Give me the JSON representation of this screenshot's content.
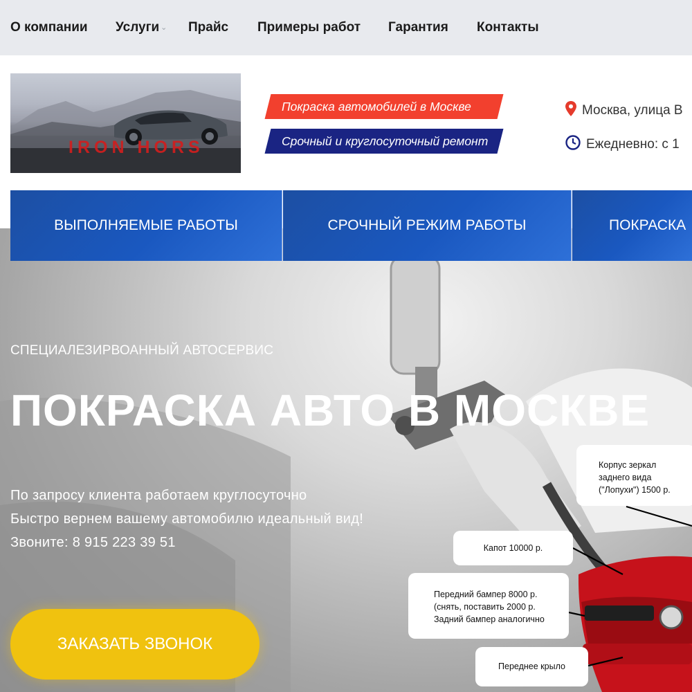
{
  "topnav": {
    "items": [
      "О компании",
      "Услуги",
      "Прайс",
      "Примеры работ",
      "Гарантия",
      "Контакты"
    ],
    "dropdown_caret": "⌄"
  },
  "header": {
    "logo_text": "IRON HORS",
    "tagline_1": "Покраска автомобилей в Москве",
    "tagline_2": "Срочный и круглосуточный ремонт",
    "address": "Москва, улица В",
    "hours": "Ежедневно: с 1"
  },
  "menu": {
    "items": [
      "ВЫПОЛНЯЕМЫЕ РАБОТЫ",
      "СРОЧНЫЙ РЕЖИМ РАБОТЫ",
      "ПОКРАСКА"
    ]
  },
  "hero": {
    "subtitle": "СПЕЦИАЛЕЗИРВОАННЫЙ АВТОСЕРВИС",
    "title": "ПОКРАСКА АВТО В МОСКВЕ",
    "line_1": "По запросу клиента работаем круглосуточно",
    "line_2": "Быстро вернем вашему автомобилю идеальный вид!",
    "line_3": "Звоните: 8 915 223 39 51",
    "cta": "ЗАКАЗАТЬ ЗВОНОК"
  },
  "callouts": {
    "mirror": [
      "Корпус зеркал",
      "заднего вида",
      "(\"Лопухи\") 1500 р."
    ],
    "hood": "Капот 10000 р.",
    "bumper": [
      "Передний бампер 8000 р.",
      "(снять, поставить 2000 р.",
      "Задний бампер аналогично"
    ],
    "fender": "Переднее крыло"
  },
  "colors": {
    "tag_red": "#f2402e",
    "tag_navy": "#1a2483",
    "menu_blue": "#1a58c0",
    "cta_yellow": "#f0c20f",
    "icon_red": "#e53b2c",
    "icon_navy": "#1a2483"
  },
  "icons": {
    "address": "map-pin-icon",
    "hours": "clock-icon"
  }
}
